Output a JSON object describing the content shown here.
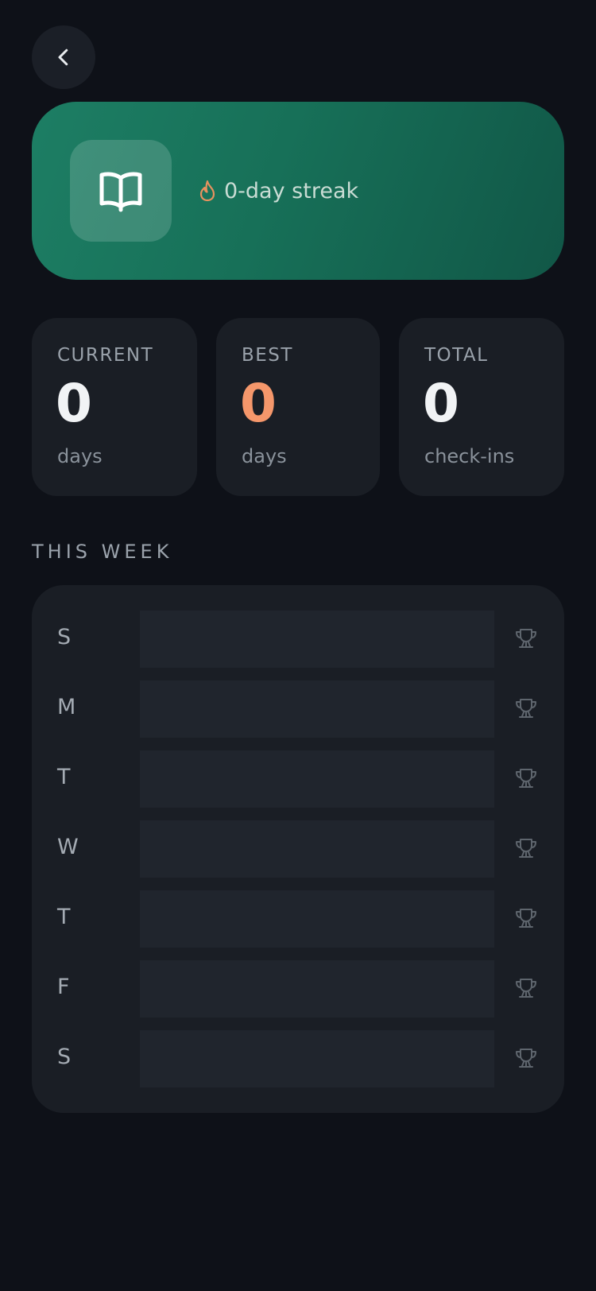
{
  "header": {
    "back_icon": "chevron-left-icon"
  },
  "hero": {
    "habit_icon": "open-book-icon",
    "streak_icon": "flame-icon",
    "streak_text": "0-day streak",
    "gradient_colors": [
      "#1d7e64",
      "#115747"
    ],
    "flame_color": "#e8925f"
  },
  "stats": {
    "current": {
      "label": "CURRENT",
      "value": "0",
      "unit": "days"
    },
    "best": {
      "label": "BEST",
      "value": "0",
      "unit": "days",
      "accent": "#f5976b"
    },
    "total": {
      "label": "TOTAL",
      "value": "0",
      "unit": "check-ins"
    }
  },
  "week": {
    "title": "THIS WEEK",
    "trophy_icon": "trophy-icon",
    "days": [
      {
        "label": "S",
        "progress": 0
      },
      {
        "label": "M",
        "progress": 0
      },
      {
        "label": "T",
        "progress": 0
      },
      {
        "label": "W",
        "progress": 0
      },
      {
        "label": "T",
        "progress": 0
      },
      {
        "label": "F",
        "progress": 0
      },
      {
        "label": "S",
        "progress": 0
      }
    ]
  }
}
